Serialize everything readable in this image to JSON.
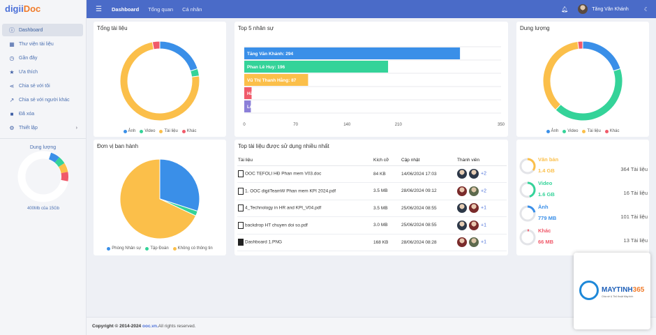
{
  "app": {
    "logo_part1": "digii",
    "logo_part2": "Doc"
  },
  "sidebar": {
    "items": [
      {
        "label": "Dashboard",
        "icon": "info-circle-icon",
        "glyph": "ⓘ"
      },
      {
        "label": "Thư viện tài liệu",
        "icon": "library-icon",
        "glyph": "▦"
      },
      {
        "label": "Gần đây",
        "icon": "clock-icon",
        "glyph": "◷"
      },
      {
        "label": "Ưa thích",
        "icon": "star-icon",
        "glyph": "★"
      },
      {
        "label": "Chia sẻ với tôi",
        "icon": "share-icon",
        "glyph": "⋖"
      },
      {
        "label": "Chia sẻ với người khác",
        "icon": "share-out-icon",
        "glyph": "↗"
      },
      {
        "label": "Đã xóa",
        "icon": "trash-icon",
        "glyph": "■"
      },
      {
        "label": "Thiết lập",
        "icon": "settings-icon",
        "glyph": "⚙"
      }
    ],
    "storage_title": "Dung lượng",
    "storage_sub": "400Mb của 15Gb",
    "storage_fraction": 0.027
  },
  "topbar": {
    "nav": [
      "Dashboard",
      "Tổng quan",
      "Cá nhân"
    ],
    "user_name": "Tăng Văn Khánh"
  },
  "colors": {
    "blue": "#3a8fe8",
    "green": "#34d399",
    "yellow": "#fbbf4a",
    "red": "#f05a6a",
    "purple": "#8b7fd8"
  },
  "cards": {
    "total_docs": {
      "title": "Tổng tài liệu",
      "legend": [
        "Ảnh",
        "Video",
        "Tài liệu",
        "Khác"
      ]
    },
    "top5": {
      "title": "Top 5 nhân sự"
    },
    "storage": {
      "title": "Dung lượng",
      "legend": [
        "Ảnh",
        "Video",
        "Tài liệu",
        "Khác"
      ]
    },
    "units": {
      "title": "Đơn vị ban hành",
      "legend": [
        "Phòng Nhân sự",
        "Tập Đoàn",
        "Không có thông tin"
      ]
    },
    "top_docs": {
      "title": "Top tài liệu được sử dụng nhiều nhất",
      "headers": [
        "Tài liệu",
        "Kích cỡ",
        "Cập nhật",
        "Thành viên"
      ],
      "rows": [
        {
          "name": "OOC TEFOLI HĐ Phan mem V03.doc",
          "size": "84 KB",
          "updated": "14/06/2024 17:03",
          "more": "+2",
          "icon": "word-file-icon"
        },
        {
          "name": "1. OOC digiiTeamW Phan mem KPI 2024.pdf",
          "size": "3.5 MB",
          "updated": "28/06/2024 09:12",
          "more": "+2",
          "icon": "pdf-file-icon"
        },
        {
          "name": "4_Technology in HR and KPI_V04.pdf",
          "size": "3.5 MB",
          "updated": "25/06/2024 08:55",
          "more": "+1",
          "icon": "pdf-file-icon"
        },
        {
          "name": "backdrop HT chuyen doi so.pdf",
          "size": "3.0 MB",
          "updated": "25/06/2024 08:55",
          "more": "+1",
          "icon": "pdf-file-icon"
        },
        {
          "name": "Dashboard 1.PNG",
          "size": "168 KB",
          "updated": "28/06/2024 08:28",
          "more": "+1",
          "icon": "image-file-icon"
        }
      ]
    },
    "storage_list": [
      {
        "name": "Văn bản",
        "size": "1.4 GB",
        "count": "364 Tài liệu",
        "color": "#fbbf4a",
        "fraction": 0.35
      },
      {
        "name": "Video",
        "size": "1.6 GB",
        "count": "16 Tài liệu",
        "color": "#34d399",
        "fraction": 0.45
      },
      {
        "name": "Ảnh",
        "size": "779 MB",
        "count": "101 Tài liệu",
        "color": "#3a8fe8",
        "fraction": 0.22
      },
      {
        "name": "Khác",
        "size": "66 MB",
        "count": "13 Tài liệu",
        "color": "#f05a6a",
        "fraction": 0.03
      }
    ]
  },
  "footer": {
    "prefix": "Copyright © 2014-2024",
    "link": "ooc.vn.",
    "suffix": "All rights reserved."
  },
  "watermark": {
    "brand_a": "MAYTINH",
    "brand_b": "365",
    "tagline": "Chia sẻ & Thủ thuật Máy tính"
  },
  "chart_data": [
    {
      "type": "pie",
      "title": "Tổng tài liệu",
      "categories": [
        "Ảnh",
        "Video",
        "Tài liệu",
        "Khác"
      ],
      "values": [
        20,
        3,
        74,
        3
      ]
    },
    {
      "type": "bar",
      "orientation": "horizontal",
      "title": "Top 5 nhân sự",
      "categories": [
        "Tăng Văn Khánh",
        "Phan Lê Huy",
        "Vũ Thị Thanh Hằng",
        "Hàn Lập",
        "Lê Huy Hùng"
      ],
      "values": [
        294,
        196,
        87,
        10,
        9
      ],
      "xlim": [
        0,
        350
      ],
      "xticks": [
        0,
        70,
        140,
        210,
        350
      ]
    },
    {
      "type": "pie",
      "title": "Dung lượng",
      "categories": [
        "Ảnh",
        "Video",
        "Tài liệu",
        "Khác"
      ],
      "values": [
        20,
        42,
        36,
        2
      ]
    },
    {
      "type": "pie",
      "title": "Đơn vị ban hành",
      "categories": [
        "Phòng Nhân sự",
        "Tập Đoàn",
        "Không có thông tin"
      ],
      "values": [
        30,
        2,
        68
      ]
    }
  ]
}
